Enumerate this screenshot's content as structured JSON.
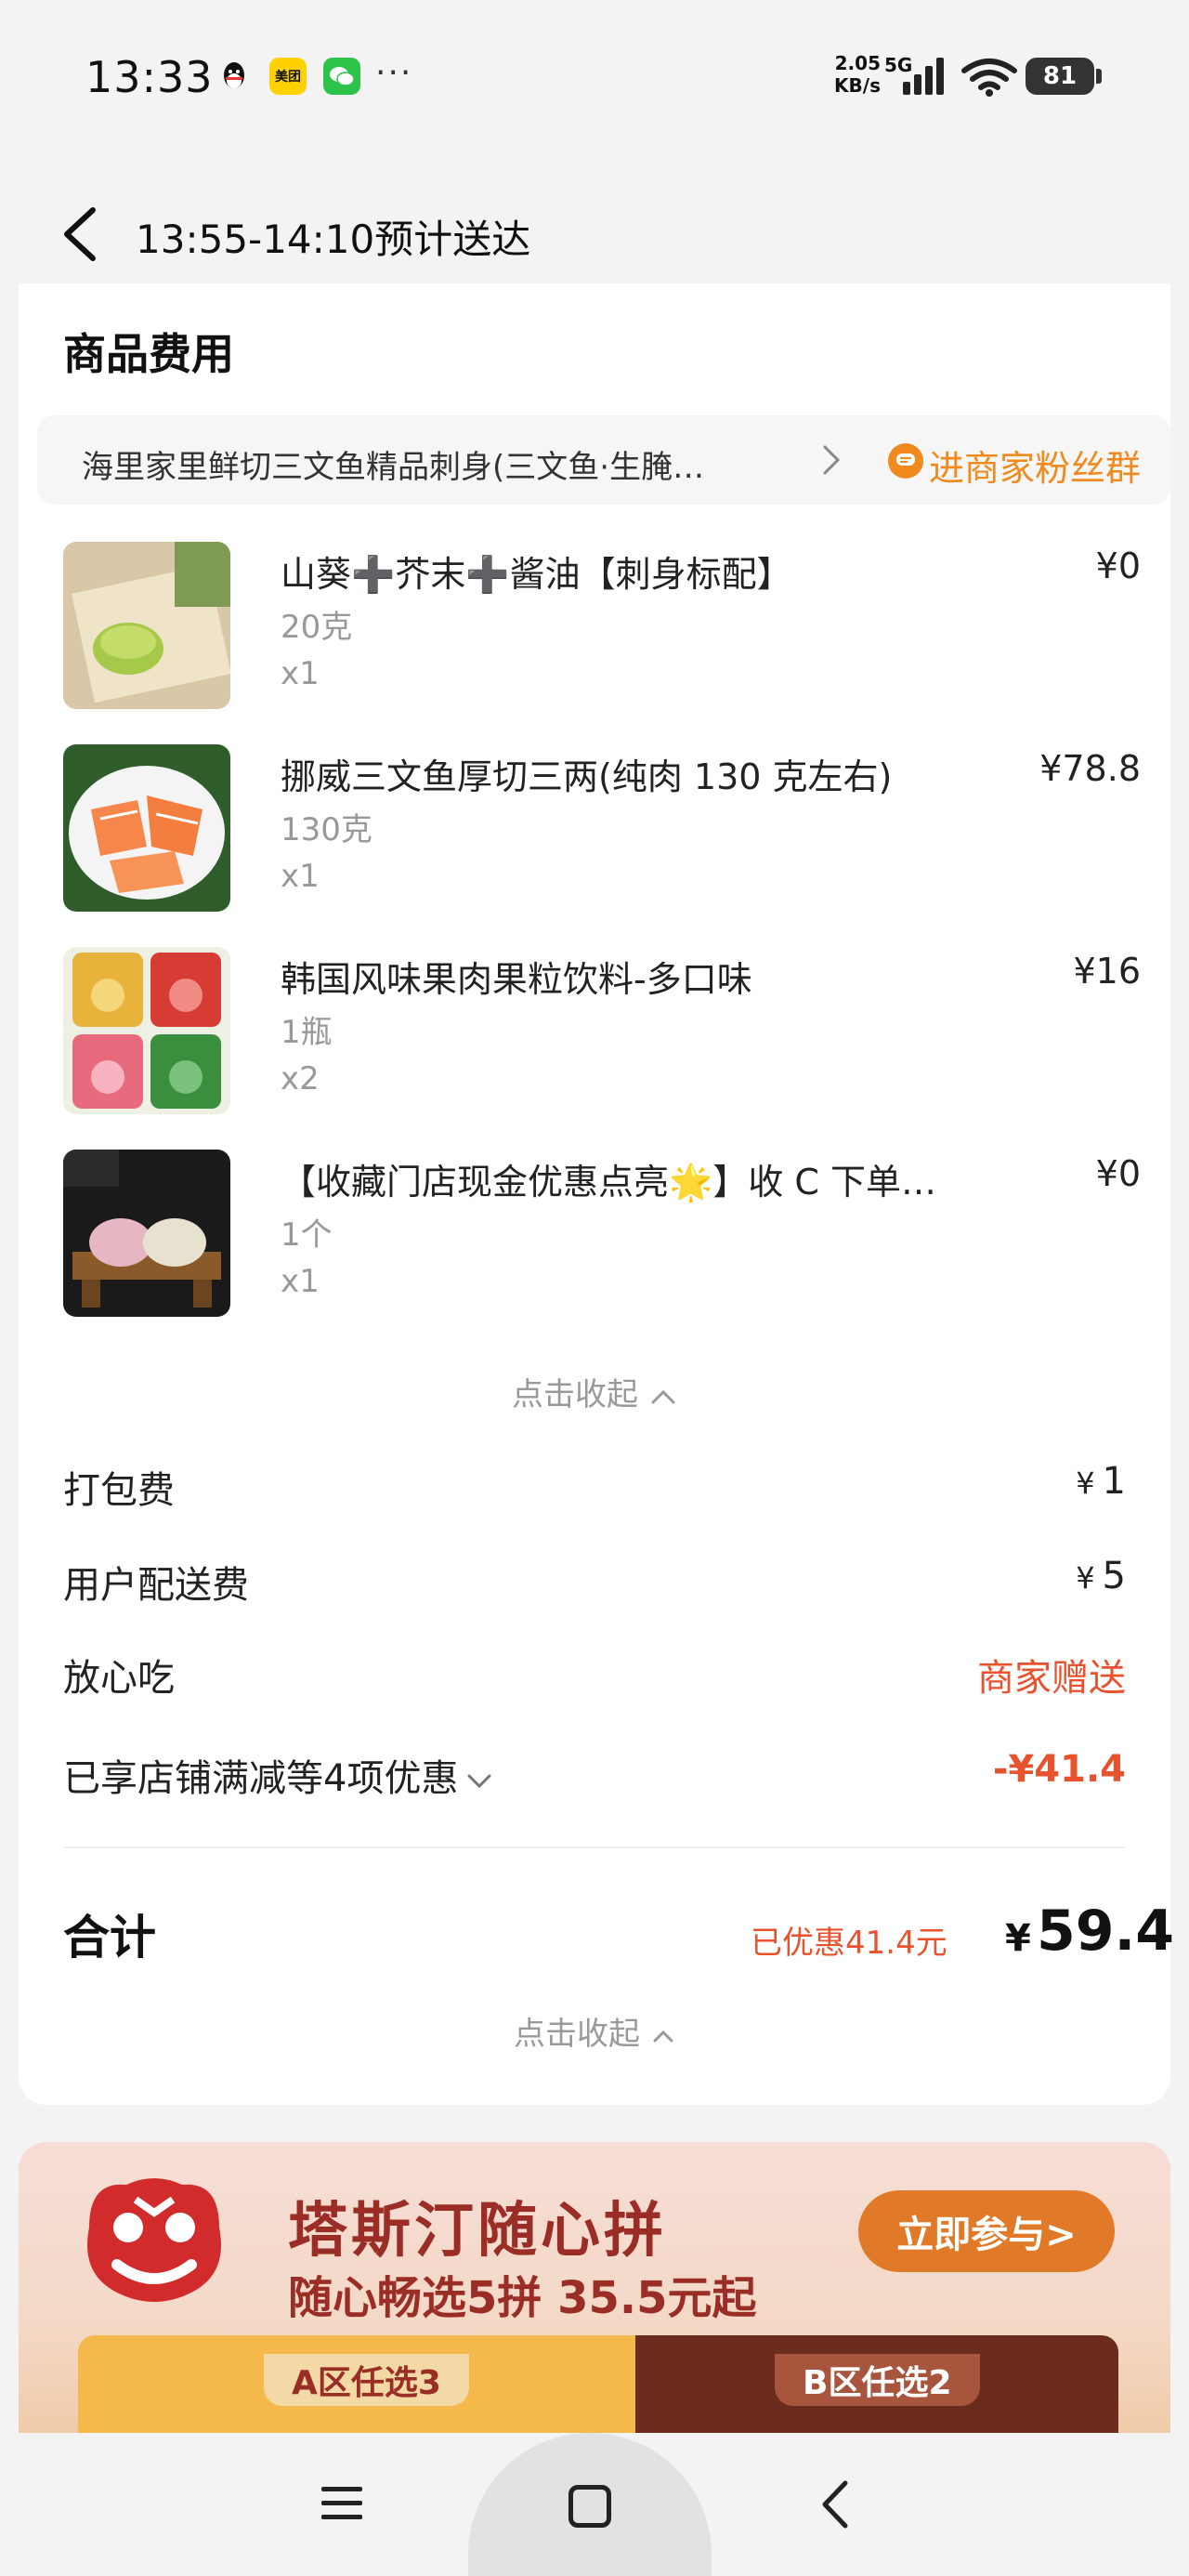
{
  "status_bar": {
    "time": "13:33",
    "apps": [
      "qq-icon",
      "meituan-icon",
      "wechat-icon"
    ],
    "meituan_label": "美团",
    "net_speed": "2.05",
    "net_unit": "KB/s",
    "network": "5G",
    "battery": "81"
  },
  "header": {
    "title": "13:55-14:10预计送达"
  },
  "section": {
    "title": "商品费用"
  },
  "shop": {
    "name": "海里家里鲜切三文鱼精品刺身(三文鱼·生腌…",
    "fan_group": "进商家粉丝群"
  },
  "items": [
    {
      "name": "山葵➕芥末➕酱油【刺身标配】",
      "spec": "20克",
      "qty": "x1",
      "price": "¥0"
    },
    {
      "name": "挪威三文鱼厚切三两(纯肉 130 克左右)",
      "spec": "130克",
      "qty": "x1",
      "price": "¥78.8"
    },
    {
      "name": "韩国风味果肉果粒饮料-多口味",
      "spec": "1瓶",
      "qty": "x2",
      "price": "¥16"
    },
    {
      "name": "【收藏门店现金优惠点亮🌟】收 C 下单…",
      "spec": "1个",
      "qty": "x1",
      "price": "¥0"
    }
  ],
  "collapse_label": "点击收起",
  "fees": {
    "packing": {
      "label": "打包费",
      "yen": "¥",
      "value": "1"
    },
    "delivery": {
      "label": "用户配送费",
      "yen": "¥",
      "value": "5"
    },
    "assurance": {
      "label": "放心吃",
      "value": "商家赠送"
    },
    "discount": {
      "label": "已享店铺满减等4项优惠",
      "value": "-¥41.4"
    }
  },
  "total": {
    "label": "合计",
    "saved": "已优惠41.4元",
    "yen": "¥",
    "value": "59.4"
  },
  "banner": {
    "title": "塔斯汀随心拼",
    "subtitle": "随心畅选5拼 35.5元起",
    "button": "立即参与>",
    "zone_a": "A区任选3",
    "zone_b": "B区任选2"
  },
  "colors": {
    "accent_orange": "#f08a1f",
    "discount_red": "#e8522d",
    "banner_red": "#9a2e26"
  }
}
